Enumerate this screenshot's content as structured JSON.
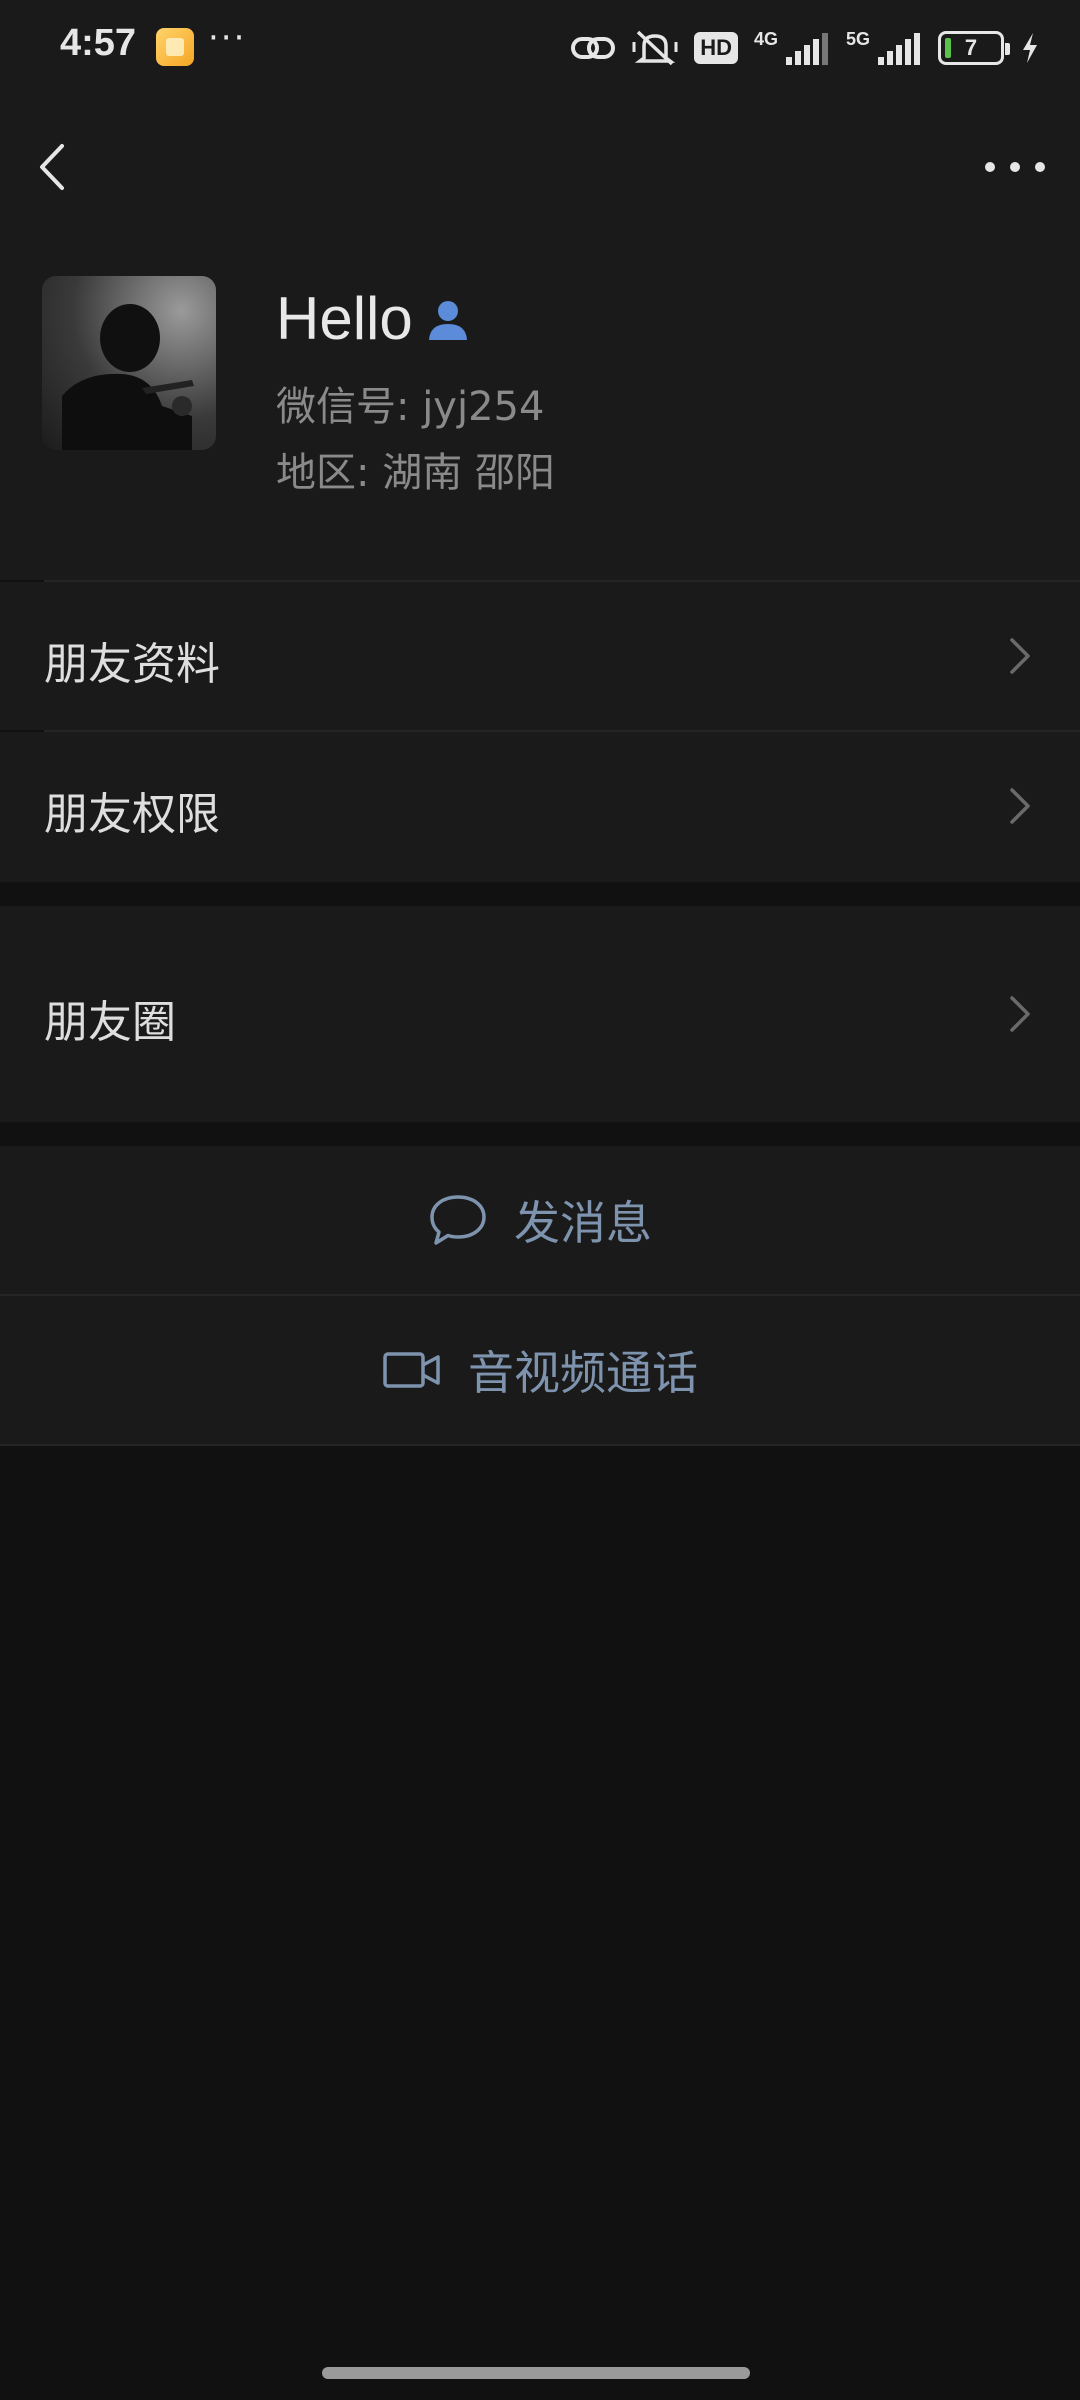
{
  "status_bar": {
    "time": "4:57",
    "hd_label": "HD",
    "net_4g": "4G",
    "net_5g": "5G",
    "battery_level": "7",
    "icons": [
      "app-notification-icon",
      "more-dots-icon",
      "link-icon",
      "mute-icon",
      "signal-icon",
      "battery-icon",
      "charging-icon"
    ]
  },
  "profile": {
    "name": "Hello",
    "wechat_id": "微信号:  jyj254",
    "region": "地区:  湖南  邵阳"
  },
  "menu": {
    "friend_info": "朋友资料",
    "friend_permissions": "朋友权限",
    "moments": "朋友圈"
  },
  "actions": {
    "send_message": "发消息",
    "av_call": "音视频通话"
  },
  "colors": {
    "background": "#111111",
    "surface": "#1a1a1a",
    "accent_text": "#7e93ad",
    "contact_icon": "#5b8bd9"
  }
}
